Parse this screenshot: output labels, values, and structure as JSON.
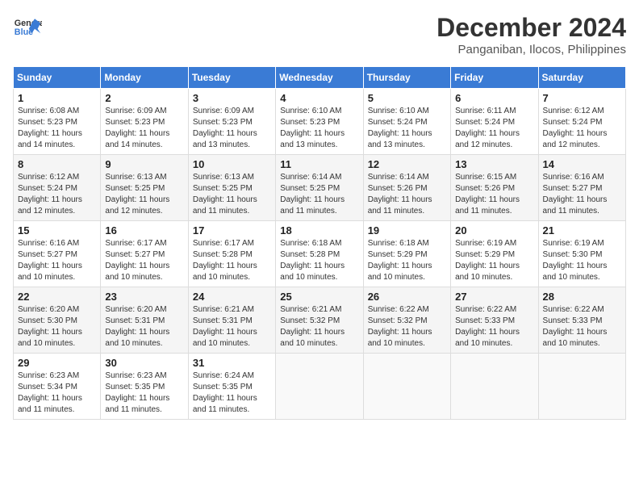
{
  "header": {
    "logo_line1": "General",
    "logo_line2": "Blue",
    "month_year": "December 2024",
    "location": "Panganiban, Ilocos, Philippines"
  },
  "calendar": {
    "days_of_week": [
      "Sunday",
      "Monday",
      "Tuesday",
      "Wednesday",
      "Thursday",
      "Friday",
      "Saturday"
    ],
    "weeks": [
      [
        null,
        {
          "day": "2",
          "sunrise": "6:09 AM",
          "sunset": "5:23 PM",
          "daylight": "11 hours and 14 minutes."
        },
        {
          "day": "3",
          "sunrise": "6:09 AM",
          "sunset": "5:23 PM",
          "daylight": "11 hours and 13 minutes."
        },
        {
          "day": "4",
          "sunrise": "6:10 AM",
          "sunset": "5:23 PM",
          "daylight": "11 hours and 13 minutes."
        },
        {
          "day": "5",
          "sunrise": "6:10 AM",
          "sunset": "5:24 PM",
          "daylight": "11 hours and 13 minutes."
        },
        {
          "day": "6",
          "sunrise": "6:11 AM",
          "sunset": "5:24 PM",
          "daylight": "11 hours and 12 minutes."
        },
        {
          "day": "7",
          "sunrise": "6:12 AM",
          "sunset": "5:24 PM",
          "daylight": "11 hours and 12 minutes."
        }
      ],
      [
        {
          "day": "1",
          "sunrise": "6:08 AM",
          "sunset": "5:23 PM",
          "daylight": "11 hours and 14 minutes."
        },
        {
          "day": "9",
          "sunrise": "6:13 AM",
          "sunset": "5:25 PM",
          "daylight": "11 hours and 12 minutes."
        },
        {
          "day": "10",
          "sunrise": "6:13 AM",
          "sunset": "5:25 PM",
          "daylight": "11 hours and 11 minutes."
        },
        {
          "day": "11",
          "sunrise": "6:14 AM",
          "sunset": "5:25 PM",
          "daylight": "11 hours and 11 minutes."
        },
        {
          "day": "12",
          "sunrise": "6:14 AM",
          "sunset": "5:26 PM",
          "daylight": "11 hours and 11 minutes."
        },
        {
          "day": "13",
          "sunrise": "6:15 AM",
          "sunset": "5:26 PM",
          "daylight": "11 hours and 11 minutes."
        },
        {
          "day": "14",
          "sunrise": "6:16 AM",
          "sunset": "5:27 PM",
          "daylight": "11 hours and 11 minutes."
        }
      ],
      [
        {
          "day": "8",
          "sunrise": "6:12 AM",
          "sunset": "5:24 PM",
          "daylight": "11 hours and 12 minutes."
        },
        {
          "day": "16",
          "sunrise": "6:17 AM",
          "sunset": "5:27 PM",
          "daylight": "11 hours and 10 minutes."
        },
        {
          "day": "17",
          "sunrise": "6:17 AM",
          "sunset": "5:28 PM",
          "daylight": "11 hours and 10 minutes."
        },
        {
          "day": "18",
          "sunrise": "6:18 AM",
          "sunset": "5:28 PM",
          "daylight": "11 hours and 10 minutes."
        },
        {
          "day": "19",
          "sunrise": "6:18 AM",
          "sunset": "5:29 PM",
          "daylight": "11 hours and 10 minutes."
        },
        {
          "day": "20",
          "sunrise": "6:19 AM",
          "sunset": "5:29 PM",
          "daylight": "11 hours and 10 minutes."
        },
        {
          "day": "21",
          "sunrise": "6:19 AM",
          "sunset": "5:30 PM",
          "daylight": "11 hours and 10 minutes."
        }
      ],
      [
        {
          "day": "15",
          "sunrise": "6:16 AM",
          "sunset": "5:27 PM",
          "daylight": "11 hours and 10 minutes."
        },
        {
          "day": "23",
          "sunrise": "6:20 AM",
          "sunset": "5:31 PM",
          "daylight": "11 hours and 10 minutes."
        },
        {
          "day": "24",
          "sunrise": "6:21 AM",
          "sunset": "5:31 PM",
          "daylight": "11 hours and 10 minutes."
        },
        {
          "day": "25",
          "sunrise": "6:21 AM",
          "sunset": "5:32 PM",
          "daylight": "11 hours and 10 minutes."
        },
        {
          "day": "26",
          "sunrise": "6:22 AM",
          "sunset": "5:32 PM",
          "daylight": "11 hours and 10 minutes."
        },
        {
          "day": "27",
          "sunrise": "6:22 AM",
          "sunset": "5:33 PM",
          "daylight": "11 hours and 10 minutes."
        },
        {
          "day": "28",
          "sunrise": "6:22 AM",
          "sunset": "5:33 PM",
          "daylight": "11 hours and 10 minutes."
        }
      ],
      [
        {
          "day": "22",
          "sunrise": "6:20 AM",
          "sunset": "5:30 PM",
          "daylight": "11 hours and 10 minutes."
        },
        {
          "day": "30",
          "sunrise": "6:23 AM",
          "sunset": "5:35 PM",
          "daylight": "11 hours and 11 minutes."
        },
        {
          "day": "31",
          "sunrise": "6:24 AM",
          "sunset": "5:35 PM",
          "daylight": "11 hours and 11 minutes."
        },
        null,
        null,
        null,
        null
      ],
      [
        {
          "day": "29",
          "sunrise": "6:23 AM",
          "sunset": "5:34 PM",
          "daylight": "11 hours and 11 minutes."
        },
        null,
        null,
        null,
        null,
        null,
        null
      ]
    ]
  }
}
